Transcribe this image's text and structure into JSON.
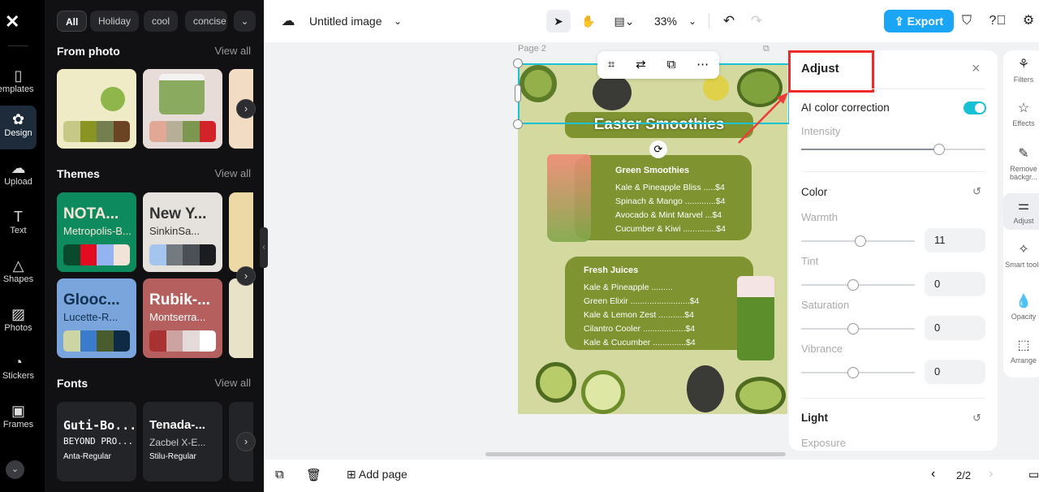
{
  "rail": {
    "items": [
      {
        "label": "Templates",
        "icon": "templates-icon"
      },
      {
        "label": "Design",
        "icon": "design-icon"
      },
      {
        "label": "Upload",
        "icon": "upload-icon"
      },
      {
        "label": "Text",
        "icon": "text-icon"
      },
      {
        "label": "Shapes",
        "icon": "shapes-icon"
      },
      {
        "label": "Photos",
        "icon": "photos-icon"
      },
      {
        "label": "Stickers",
        "icon": "stickers-icon"
      },
      {
        "label": "Frames",
        "icon": "frames-icon"
      }
    ]
  },
  "panel": {
    "chips": [
      "All",
      "Holiday",
      "cool",
      "concise"
    ],
    "from_photo": {
      "title": "From photo",
      "view_all": "View all",
      "palettes": [
        [
          "#c6c985",
          "#8a9422",
          "#737f4e",
          "#6b4424"
        ],
        [
          "#e1a995",
          "#b6ae96",
          "#7b9750",
          "#d22328"
        ]
      ]
    },
    "themes": {
      "title": "Themes",
      "view_all": "View all",
      "cards": [
        {
          "t1": "NOTA...",
          "t2": "Metropolis-B...",
          "bg": "#0e8a5f",
          "fg": "#f7e6d8",
          "colors": [
            "#0a4a2c",
            "#e30b1f",
            "#93b4f0",
            "#f2e3d8"
          ]
        },
        {
          "t1": "New Y...",
          "t2": "SinkinSa...",
          "bg": "#e5e2dd",
          "fg": "#333",
          "colors": [
            "#a4c6ee",
            "#747b80",
            "#4b4f56",
            "#1a1c20"
          ]
        },
        {
          "t1": "Glooc...",
          "t2": "Lucette-R...",
          "bg": "#79a5dc",
          "fg": "#12304f",
          "colors": [
            "#cdd5a5",
            "#3b7bcc",
            "#4a5b2c",
            "#0e2a45"
          ]
        },
        {
          "t1": "Rubik-...",
          "t2": "Montserra...",
          "bg": "#b5605e",
          "fg": "#fff",
          "colors": [
            "#a83232",
            "#cda3a2",
            "#e4dada",
            "#ffffff"
          ]
        }
      ]
    },
    "fonts": {
      "title": "Fonts",
      "view_all": "View all",
      "cards": [
        {
          "t1": "Guti-Bo...",
          "t2": "BEYOND PRO...",
          "t3": "Anta-Regular"
        },
        {
          "t1": "Tenada-...",
          "t2": "Zacbel X-E...",
          "t3": "Stilu-Regular"
        }
      ]
    }
  },
  "top": {
    "title": "Untitled image",
    "zoom": "33%",
    "export": "Export",
    "accent": "#1aa5f5"
  },
  "canvas": {
    "page_label": "Page 2",
    "menu": {
      "title": "Easter Smoothies",
      "green": {
        "title": "Green Smoothies",
        "items": [
          "Kale & Pineapple Bliss .....$4",
          "Spinach & Mango .............$4",
          "Avocado & Mint Marvel ...$4",
          "Cucumber & Kiwi ..............$4"
        ]
      },
      "juices": {
        "title": "Fresh Juices",
        "items": [
          "Kale & Pineapple .........",
          "Green Elixir .........................$4",
          "Kale & Lemon Zest ...........$4",
          "Cilantro Cooler ..................$4",
          "Kale & Cucumber ..............$4"
        ]
      }
    }
  },
  "adjust": {
    "title": "Adjust",
    "ai": "AI color correction",
    "ai_on": true,
    "intensity": "Intensity",
    "intensity_value": 0.75,
    "color": "Color",
    "sliders": [
      {
        "label": "Warmth",
        "value": "11"
      },
      {
        "label": "Tint",
        "value": "0"
      },
      {
        "label": "Saturation",
        "value": "0"
      },
      {
        "label": "Vibrance",
        "value": "0"
      }
    ],
    "light": "Light",
    "exposure": "Exposure"
  },
  "tools": [
    {
      "label": "Filters",
      "icon": "filters-icon"
    },
    {
      "label": "Effects",
      "icon": "effects-icon"
    },
    {
      "label": "Remove backgr...",
      "icon": "remove-background-icon"
    },
    {
      "label": "Adjust",
      "icon": "adjust-icon"
    },
    {
      "label": "Smart tools",
      "icon": "smart-tools-icon"
    },
    {
      "label": "Opacity",
      "icon": "opacity-icon"
    },
    {
      "label": "Arrange",
      "icon": "arrange-icon"
    }
  ],
  "bottom": {
    "add_page": "Add page",
    "page": "2/2"
  }
}
